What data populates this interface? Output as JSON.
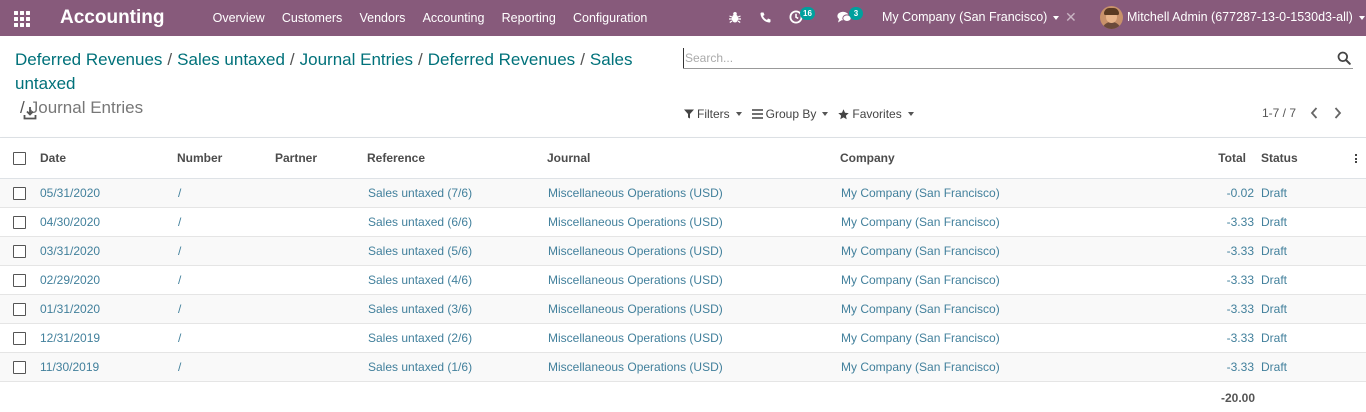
{
  "navbar": {
    "app_title": "Accounting",
    "menu": [
      "Overview",
      "Customers",
      "Vendors",
      "Accounting",
      "Reporting",
      "Configuration"
    ],
    "activity_count": "16",
    "message_count": "3",
    "company": "My Company (San Francisco)",
    "user": "Mitchell Admin (677287-13-0-1530d3-all)",
    "color": "#875a7b",
    "badge_color": "#00a09d"
  },
  "breadcrumb": {
    "items": [
      "Deferred Revenues",
      "Sales untaxed",
      "Journal Entries",
      "Deferred Revenues",
      "Sales untaxed"
    ],
    "current": "Journal Entries",
    "separator": "/"
  },
  "search": {
    "placeholder": "Search..."
  },
  "filters": {
    "filters_label": "Filters",
    "groupby_label": "Group By",
    "favorites_label": "Favorites"
  },
  "pager": {
    "text": "1-7 / 7"
  },
  "table": {
    "headers": {
      "date": "Date",
      "number": "Number",
      "partner": "Partner",
      "reference": "Reference",
      "journal": "Journal",
      "company": "Company",
      "total": "Total",
      "status": "Status"
    },
    "rows": [
      {
        "date": "05/31/2020",
        "number": "/",
        "partner": "",
        "reference": "Sales untaxed (7/6)",
        "journal": "Miscellaneous Operations (USD)",
        "company": "My Company (San Francisco)",
        "total": "-0.02",
        "status": "Draft"
      },
      {
        "date": "04/30/2020",
        "number": "/",
        "partner": "",
        "reference": "Sales untaxed (6/6)",
        "journal": "Miscellaneous Operations (USD)",
        "company": "My Company (San Francisco)",
        "total": "-3.33",
        "status": "Draft"
      },
      {
        "date": "03/31/2020",
        "number": "/",
        "partner": "",
        "reference": "Sales untaxed (5/6)",
        "journal": "Miscellaneous Operations (USD)",
        "company": "My Company (San Francisco)",
        "total": "-3.33",
        "status": "Draft"
      },
      {
        "date": "02/29/2020",
        "number": "/",
        "partner": "",
        "reference": "Sales untaxed (4/6)",
        "journal": "Miscellaneous Operations (USD)",
        "company": "My Company (San Francisco)",
        "total": "-3.33",
        "status": "Draft"
      },
      {
        "date": "01/31/2020",
        "number": "/",
        "partner": "",
        "reference": "Sales untaxed (3/6)",
        "journal": "Miscellaneous Operations (USD)",
        "company": "My Company (San Francisco)",
        "total": "-3.33",
        "status": "Draft"
      },
      {
        "date": "12/31/2019",
        "number": "/",
        "partner": "",
        "reference": "Sales untaxed (2/6)",
        "journal": "Miscellaneous Operations (USD)",
        "company": "My Company (San Francisco)",
        "total": "-3.33",
        "status": "Draft"
      },
      {
        "date": "11/30/2019",
        "number": "/",
        "partner": "",
        "reference": "Sales untaxed (1/6)",
        "journal": "Miscellaneous Operations (USD)",
        "company": "My Company (San Francisco)",
        "total": "-3.33",
        "status": "Draft"
      }
    ],
    "footer_total": "-20.00",
    "link_color": "#42809c"
  }
}
